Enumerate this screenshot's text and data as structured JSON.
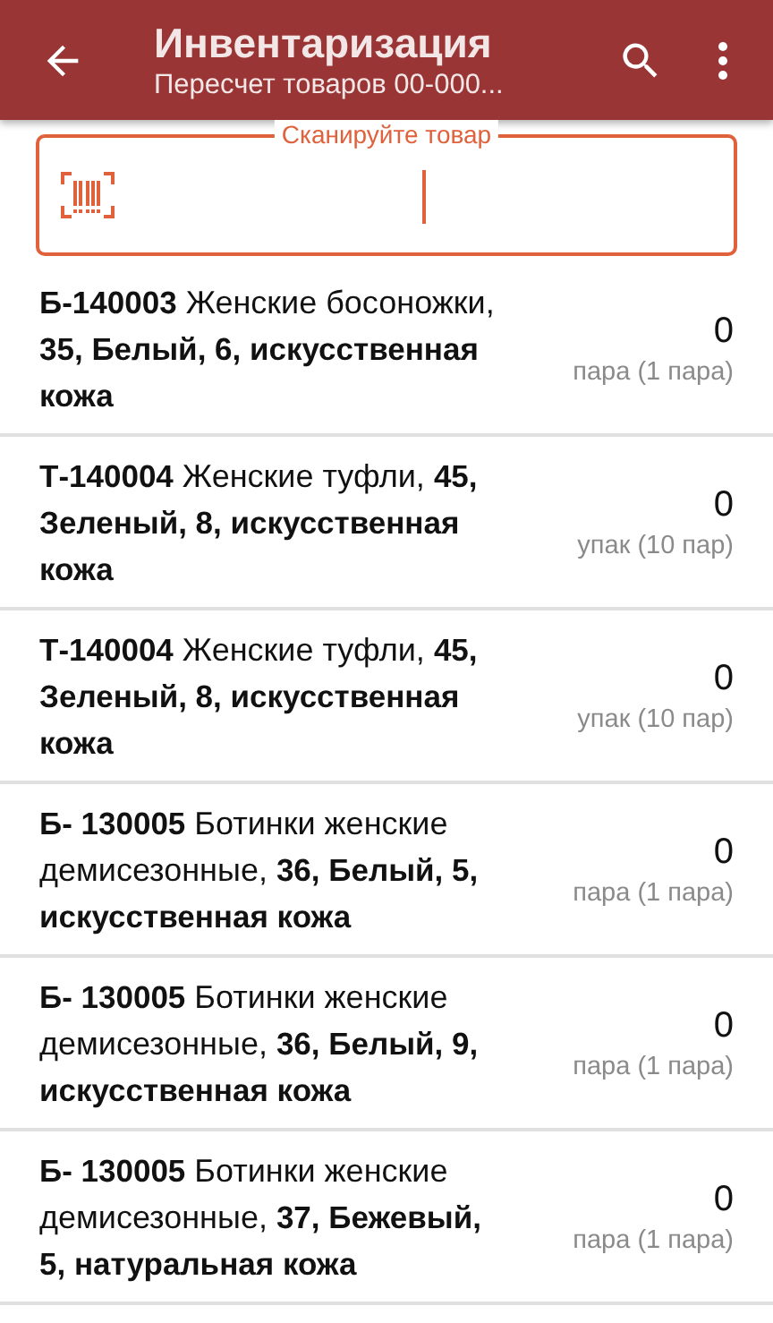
{
  "app_bar": {
    "title": "Инвентаризация",
    "subtitle": "Пересчет товаров 00-000..."
  },
  "scan_field": {
    "label": "Сканируйте товар"
  },
  "items": [
    {
      "description": "**Б-140003** Женские босоножки, **35, Белый, 6, искусственная кожа**",
      "quantity": "0",
      "unit": "пара (1 пара)"
    },
    {
      "description": "**Т-140004** Женские туфли, **45, Зеленый, 8, искусственная кожа**",
      "quantity": "0",
      "unit": "упак (10 пар)"
    },
    {
      "description": "**Т-140004** Женские туфли, **45, Зеленый, 8, искусственная кожа**",
      "quantity": "0",
      "unit": "упак (10 пар)"
    },
    {
      "description": "**Б- 130005** Ботинки женские демисезонные, **36, Белый, 5, искусственная кожа**",
      "quantity": "0",
      "unit": "пара (1 пара)"
    },
    {
      "description": "**Б- 130005** Ботинки женские демисезонные, **36, Белый, 9, искусственная кожа**",
      "quantity": "0",
      "unit": "пара (1 пара)"
    },
    {
      "description": "**Б- 130005** Ботинки женские демисезонные, **37, Бежевый, 5, натуральная кожа**",
      "quantity": "0",
      "unit": "пара (1 пара)"
    }
  ]
}
